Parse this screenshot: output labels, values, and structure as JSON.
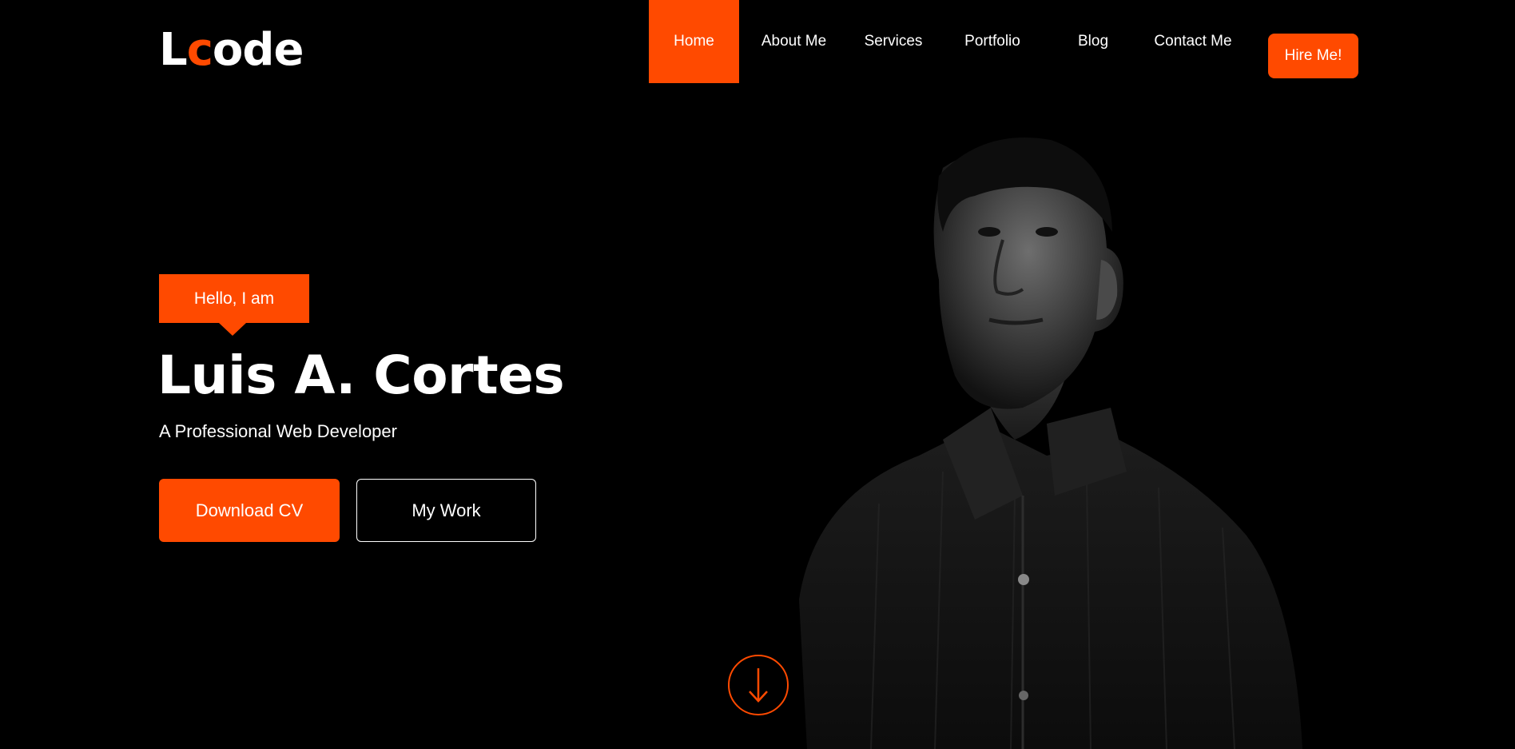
{
  "logo": {
    "pre": "L",
    "accent": "c",
    "post": "ode"
  },
  "nav": {
    "items": [
      {
        "label": "Home"
      },
      {
        "label": "About Me"
      },
      {
        "label": "Services"
      },
      {
        "label": "Portfolio"
      },
      {
        "label": "Blog"
      },
      {
        "label": "Contact Me"
      }
    ],
    "active": "Home",
    "hire_label": "Hire Me!"
  },
  "hero": {
    "greeting": "Hello, I am",
    "name": "Luis A. Cortes",
    "subtitle": "A Professional Web Developer",
    "download_label": "Download CV",
    "work_label": "My Work"
  },
  "colors": {
    "accent": "#ff4a00",
    "background": "#000000",
    "text": "#ffffff"
  },
  "icons": {
    "scroll": "arrow-down-icon",
    "portrait": "person-portrait"
  }
}
